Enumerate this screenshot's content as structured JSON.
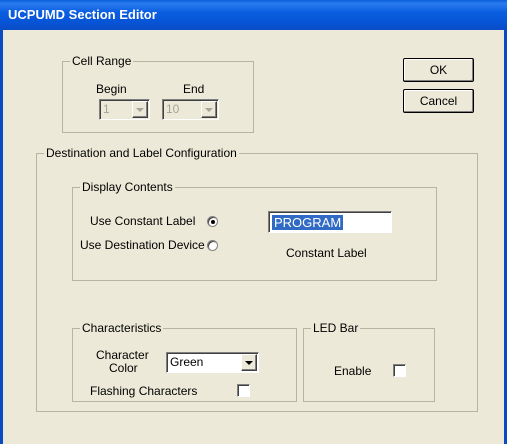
{
  "window": {
    "title": "UCPUMD Section Editor"
  },
  "cell_range": {
    "title": "Cell Range",
    "begin_label": "Begin",
    "end_label": "End",
    "begin_value": "1",
    "end_value": "10"
  },
  "buttons": {
    "ok": "OK",
    "cancel": "Cancel"
  },
  "dest_config": {
    "title": "Destination and Label Configuration",
    "display_contents": {
      "title": "Display Contents",
      "use_constant_label": "Use Constant Label",
      "use_destination_device": "Use Destination Device",
      "constant_label_value": "PROGRAM",
      "constant_label_caption": "Constant Label",
      "selected": "Use Constant Label"
    },
    "characteristics": {
      "title": "Characteristics",
      "character_color_line1": "Character",
      "character_color_line2": "Color",
      "color_value": "Green",
      "flashing_label": "Flashing Characters",
      "flashing_checked": false
    },
    "led_bar": {
      "title": "LED Bar",
      "enable_label": "Enable",
      "enable_checked": false
    }
  },
  "colors": {
    "titlebar": "#0A5FDB",
    "dialog_bg": "#ECE9D8",
    "selection": "#316AC5"
  }
}
